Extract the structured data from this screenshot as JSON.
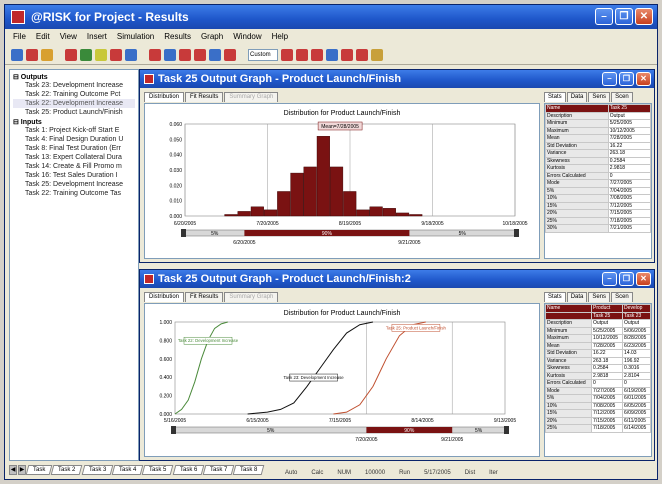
{
  "app": {
    "title": "@RISK for Project - Results"
  },
  "menu": [
    "File",
    "Edit",
    "View",
    "Insert",
    "Simulation",
    "Results",
    "Graph",
    "Window",
    "Help"
  ],
  "toolbar": {
    "zoom_select": "Custom"
  },
  "tree": {
    "groups": [
      {
        "label": "Outputs",
        "items": [
          "Task 23: Development Increase",
          "Task 22: Training Outcome Pct",
          "Task 22: Development Increase",
          "Task 25: Product Launch/Finish"
        ],
        "selected": 2
      },
      {
        "label": "Inputs",
        "items": [
          "Task 1: Project Kick-off Start E",
          "Task 4: Final Design Duration U",
          "Task 8: Final Test Duration (Err",
          "Task 13: Expert Collateral Dura",
          "Task 14: Create & Fill Promo m",
          "Task 16: Test Sales Duration I",
          "Task 25: Development Increase",
          "Task 22: Training Outcome Tas"
        ]
      }
    ]
  },
  "sheet_tabs": [
    "Task",
    "Task 2",
    "Task 3",
    "Task 4",
    "Task 5",
    "Task 6",
    "Task 7",
    "Task 8"
  ],
  "status": [
    "Auto",
    "Calc",
    "NUM",
    "100000",
    "Run",
    "5/17/2005",
    "Dist",
    "Iter"
  ],
  "window1": {
    "title": "Task 25 Output Graph - Product Launch/Finish",
    "tabs": [
      "Distribution",
      "Fit Results",
      "Summary Graph"
    ],
    "right_tabs": [
      "Stats",
      "Data",
      "Sens",
      "Scen"
    ],
    "chart_data": {
      "type": "bar",
      "title": "Distribution for Product Launch/Finish",
      "annotation": "Mean=7/28/2005",
      "x_ticks": [
        "6/20/2005",
        "7/20/2005",
        "8/19/2005",
        "9/18/2005",
        "10/18/2005"
      ],
      "y_ticks": [
        "0.000",
        "0.010",
        "0.020",
        "0.030",
        "0.040",
        "0.050",
        "0.060"
      ],
      "ylim": [
        0,
        0.06
      ],
      "values": [
        0.001,
        0.003,
        0.006,
        0.004,
        0.016,
        0.028,
        0.032,
        0.052,
        0.032,
        0.016,
        0.004,
        0.006,
        0.005,
        0.002,
        0.001
      ],
      "bar_color": "#7a1212",
      "slider_labels": [
        "5%",
        "90%",
        "5%"
      ],
      "slider_values": [
        "6/20/2005",
        "9/21/2005"
      ]
    },
    "stats_header": [
      "Name",
      "Task 25"
    ],
    "stats_rows": [
      [
        "Description",
        "Output"
      ],
      [
        "Minimum",
        "5/25/2005"
      ],
      [
        "Maximum",
        "10/12/2005"
      ],
      [
        "Mean",
        "7/28/2005"
      ],
      [
        "Std Deviation",
        "16.22"
      ],
      [
        "Variance",
        "263.18"
      ],
      [
        "Skewness",
        "0.2584"
      ],
      [
        "Kurtosis",
        "2.9818"
      ],
      [
        "Errors Calculated",
        "0"
      ],
      [
        "Mode",
        "7/27/2005"
      ],
      [
        "5%",
        "7/04/2005"
      ],
      [
        "10%",
        "7/08/2005"
      ],
      [
        "15%",
        "7/12/2005"
      ],
      [
        "20%",
        "7/15/2005"
      ],
      [
        "25%",
        "7/18/2005"
      ],
      [
        "30%",
        "7/21/2005"
      ]
    ]
  },
  "window2": {
    "title": "Task 25 Output Graph - Product Launch/Finish:2",
    "tabs": [
      "Distribution",
      "Fit Results",
      "Summary Graph"
    ],
    "right_tabs": [
      "Stats",
      "Data",
      "Sens",
      "Scen"
    ],
    "chart_data": {
      "type": "line",
      "title": "Distribution for Product Launch/Finish",
      "x_ticks": [
        "5/16/2005",
        "6/15/2005",
        "7/15/2005",
        "8/14/2005",
        "9/13/2005"
      ],
      "y_ticks": [
        "0.000",
        "0.200",
        "0.400",
        "0.600",
        "0.800",
        "1.000"
      ],
      "ylim": [
        0,
        1
      ],
      "series": [
        {
          "name": "Task 22: Development Increase",
          "color": "#4a8a3a",
          "x": [
            0,
            0.02,
            0.04,
            0.06,
            0.08,
            0.1,
            0.12,
            0.14,
            0.16
          ],
          "y": [
            0,
            0.05,
            0.15,
            0.35,
            0.6,
            0.8,
            0.93,
            0.98,
            1.0
          ]
        },
        {
          "name": "Task 23: Development Increase",
          "color": "#111111",
          "x": [
            0.22,
            0.28,
            0.32,
            0.36,
            0.4,
            0.44,
            0.48,
            0.52,
            0.56,
            0.6
          ],
          "y": [
            0,
            0.02,
            0.05,
            0.12,
            0.3,
            0.5,
            0.7,
            0.88,
            0.97,
            1.0
          ]
        },
        {
          "name": "Task 25: Product Launch/Finish",
          "color": "#c05030",
          "x": [
            0.48,
            0.52,
            0.56,
            0.6,
            0.64,
            0.68,
            0.72,
            0.76
          ],
          "y": [
            0,
            0.02,
            0.1,
            0.3,
            0.6,
            0.85,
            0.97,
            1.0
          ]
        }
      ],
      "slider_labels": [
        "5%",
        "90%",
        "5%"
      ],
      "slider_values": [
        "7/20/2005",
        "9/21/2005"
      ]
    },
    "stats_header": [
      "Name",
      "Product",
      "Develop"
    ],
    "stats_header2": [
      "",
      "Task 25",
      "Task 23"
    ],
    "stats_rows": [
      [
        "Description",
        "Output",
        "Output"
      ],
      [
        "Minimum",
        "5/25/2005",
        "5/06/2005"
      ],
      [
        "Maximum",
        "10/12/2005",
        "8/28/2005"
      ],
      [
        "Mean",
        "7/28/2005",
        "6/23/2005"
      ],
      [
        "Std Deviation",
        "16.22",
        "14.03"
      ],
      [
        "Variance",
        "263.18",
        "196.92"
      ],
      [
        "Skewness",
        "0.2584",
        "0.3016"
      ],
      [
        "Kurtosis",
        "2.9818",
        "2.8104"
      ],
      [
        "Errors Calculated",
        "0",
        "0"
      ],
      [
        "Mode",
        "7/27/2005",
        "6/19/2005"
      ],
      [
        "5%",
        "7/04/2005",
        "6/01/2005"
      ],
      [
        "10%",
        "7/08/2005",
        "6/05/2005"
      ],
      [
        "15%",
        "7/12/2005",
        "6/09/2005"
      ],
      [
        "20%",
        "7/15/2005",
        "6/11/2005"
      ],
      [
        "25%",
        "7/18/2005",
        "6/14/2005"
      ]
    ]
  }
}
